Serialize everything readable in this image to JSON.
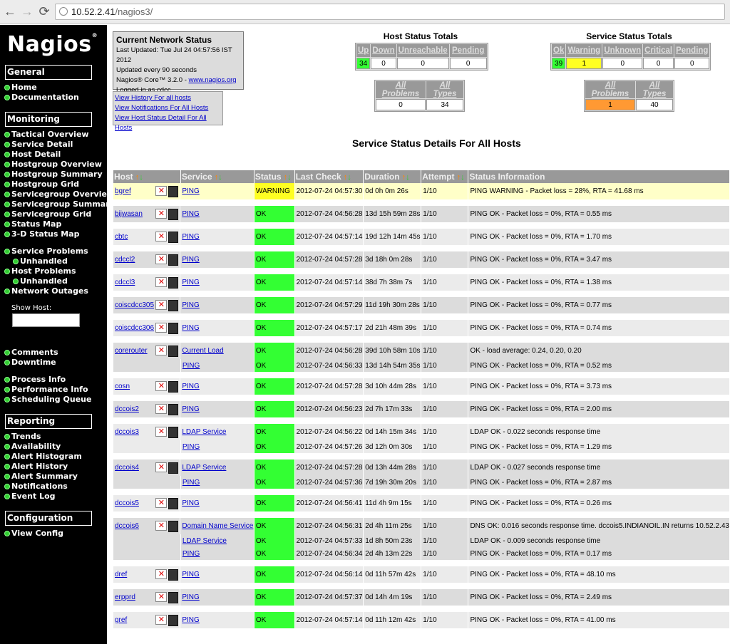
{
  "browser": {
    "host": "10.52.2.41",
    "path": "/nagios3/"
  },
  "logo": "Nagios",
  "sidebar": {
    "general": {
      "title": "General",
      "items": [
        "Home",
        "Documentation"
      ]
    },
    "monitoring": {
      "title": "Monitoring",
      "items": [
        "Tactical Overview",
        "Service Detail",
        "Host Detail",
        "Hostgroup Overview",
        "Hostgroup Summary",
        "Hostgroup Grid",
        "Servicegroup Overview",
        "Servicegroup Summary",
        "Servicegroup Grid",
        "Status Map",
        "3-D Status Map"
      ]
    },
    "problems": [
      "Service Problems",
      "Unhandled",
      "Host Problems",
      "Unhandled",
      "Network Outages"
    ],
    "show_host_label": "Show Host:",
    "misc": [
      "Comments",
      "Downtime",
      "Process Info",
      "Performance Info",
      "Scheduling Queue"
    ],
    "reporting": {
      "title": "Reporting",
      "items": [
        "Trends",
        "Availability",
        "Alert Histogram",
        "Alert History",
        "Alert Summary",
        "Notifications",
        "Event Log"
      ]
    },
    "configuration": {
      "title": "Configuration",
      "items": [
        "View Config"
      ]
    }
  },
  "status_box": {
    "title": "Current Network Status",
    "updated": "Last Updated: Tue Jul 24 04:57:56 IST 2012",
    "interval": "Updated every 90 seconds",
    "version_prefix": "Nagios® Core™ 3.2.0 - ",
    "version_link": "www.nagios.org",
    "logged": "Logged in as cdcc",
    "links": [
      "View History For all hosts",
      "View Notifications For All Hosts",
      "View Host Status Detail For All Hosts"
    ]
  },
  "host_totals": {
    "title": "Host Status Totals",
    "headers": [
      "Up",
      "Down",
      "Unreachable",
      "Pending"
    ],
    "values": [
      "34",
      "0",
      "0",
      "0"
    ],
    "summary_headers": [
      "All Problems",
      "All Types"
    ],
    "summary_values": [
      "0",
      "34"
    ]
  },
  "service_totals": {
    "title": "Service Status Totals",
    "headers": [
      "Ok",
      "Warning",
      "Unknown",
      "Critical",
      "Pending"
    ],
    "values": [
      "39",
      "1",
      "0",
      "0",
      "0"
    ],
    "summary_headers": [
      "All Problems",
      "All Types"
    ],
    "summary_values": [
      "1",
      "40"
    ]
  },
  "page_title": "Service Status Details For All Hosts",
  "columns": [
    "Host",
    "Service",
    "Status",
    "Last Check",
    "Duration",
    "Attempt",
    "Status Information"
  ],
  "colors": {
    "ok": "#33ff33",
    "warning": "#ffff22",
    "problems": "#ff9933"
  },
  "rows": [
    {
      "host": "bgref",
      "service": "PING",
      "status": "WARNING",
      "last_check": "2012-07-24 04:57:30",
      "duration": "0d 0h 0m 26s",
      "attempt": "1/10",
      "info": "PING WARNING - Packet loss = 28%, RTA = 41.68 ms"
    },
    {
      "host": "bijwasan",
      "service": "PING",
      "status": "OK",
      "last_check": "2012-07-24 04:56:28",
      "duration": "13d 15h 59m 28s",
      "attempt": "1/10",
      "info": "PING OK - Packet loss = 0%, RTA = 0.55 ms"
    },
    {
      "host": "cbtc",
      "service": "PING",
      "status": "OK",
      "last_check": "2012-07-24 04:57:14",
      "duration": "19d 12h 14m 45s",
      "attempt": "1/10",
      "info": "PING OK - Packet loss = 0%, RTA = 1.70 ms"
    },
    {
      "host": "cdccl2",
      "service": "PING",
      "status": "OK",
      "last_check": "2012-07-24 04:57:28",
      "duration": "3d 18h 0m 28s",
      "attempt": "1/10",
      "info": "PING OK - Packet loss = 0%, RTA = 3.47 ms"
    },
    {
      "host": "cdccl3",
      "service": "PING",
      "status": "OK",
      "last_check": "2012-07-24 04:57:14",
      "duration": "38d 7h 38m 7s",
      "attempt": "1/10",
      "info": "PING OK - Packet loss = 0%, RTA = 1.38 ms"
    },
    {
      "host": "coiscdcc305",
      "service": "PING",
      "status": "OK",
      "last_check": "2012-07-24 04:57:29",
      "duration": "11d 19h 30m 28s",
      "attempt": "1/10",
      "info": "PING OK - Packet loss = 0%, RTA = 0.77 ms"
    },
    {
      "host": "coiscdcc306",
      "service": "PING",
      "status": "OK",
      "last_check": "2012-07-24 04:57:17",
      "duration": "2d 21h 48m 39s",
      "attempt": "1/10",
      "info": "PING OK - Packet loss = 0%, RTA = 0.74 ms"
    },
    {
      "host": "corerouter",
      "service": "Current Load",
      "status": "OK",
      "last_check": "2012-07-24 04:56:28",
      "duration": "39d 10h 58m 10s",
      "attempt": "1/10",
      "info": "OK - load average: 0.24, 0.20, 0.20"
    },
    {
      "host": "",
      "service": "PING",
      "status": "OK",
      "last_check": "2012-07-24 04:56:33",
      "duration": "13d 14h 54m 35s",
      "attempt": "1/10",
      "info": "PING OK - Packet loss = 0%, RTA = 0.52 ms"
    },
    {
      "host": "cosn",
      "service": "PING",
      "status": "OK",
      "last_check": "2012-07-24 04:57:28",
      "duration": "3d 10h 44m 28s",
      "attempt": "1/10",
      "info": "PING OK - Packet loss = 0%, RTA = 3.73 ms"
    },
    {
      "host": "dccois2",
      "service": "PING",
      "status": "OK",
      "last_check": "2012-07-24 04:56:23",
      "duration": "2d 7h 17m 33s",
      "attempt": "1/10",
      "info": "PING OK - Packet loss = 0%, RTA = 2.00 ms"
    },
    {
      "host": "dccois3",
      "service": "LDAP Service",
      "status": "OK",
      "last_check": "2012-07-24 04:56:22",
      "duration": "0d 14h 15m 34s",
      "attempt": "1/10",
      "info": "LDAP OK - 0.022 seconds response time"
    },
    {
      "host": "",
      "service": "PING",
      "status": "OK",
      "last_check": "2012-07-24 04:57:26",
      "duration": "3d 12h 0m 30s",
      "attempt": "1/10",
      "info": "PING OK - Packet loss = 0%, RTA = 1.29 ms"
    },
    {
      "host": "dccois4",
      "service": "LDAP Service",
      "status": "OK",
      "last_check": "2012-07-24 04:57:28",
      "duration": "0d 13h 44m 28s",
      "attempt": "1/10",
      "info": "LDAP OK - 0.027 seconds response time"
    },
    {
      "host": "",
      "service": "PING",
      "status": "OK",
      "last_check": "2012-07-24 04:57:36",
      "duration": "7d 19h 30m 20s",
      "attempt": "1/10",
      "info": "PING OK - Packet loss = 0%, RTA = 2.87 ms"
    },
    {
      "host": "dccois5",
      "service": "PING",
      "status": "OK",
      "last_check": "2012-07-24 04:56:41",
      "duration": "11d 4h 9m 15s",
      "attempt": "1/10",
      "info": "PING OK - Packet loss = 0%, RTA = 0.26 ms"
    },
    {
      "host": "dccois6",
      "service": "Domain Name Service",
      "status": "OK",
      "last_check": "2012-07-24 04:56:31",
      "duration": "2d 4h 11m 25s",
      "attempt": "1/10",
      "info": "DNS OK: 0.016 seconds response time. dccois5.INDIANOIL.IN returns 10.52.2.43"
    },
    {
      "host": "",
      "service": "LDAP Service",
      "status": "OK",
      "last_check": "2012-07-24 04:57:33",
      "duration": "1d 8h 50m 23s",
      "attempt": "1/10",
      "info": "LDAP OK - 0.009 seconds response time"
    },
    {
      "host": "",
      "service": "PING",
      "status": "OK",
      "last_check": "2012-07-24 04:56:34",
      "duration": "2d 4h 13m 22s",
      "attempt": "1/10",
      "info": "PING OK - Packet loss = 0%, RTA = 0.17 ms"
    },
    {
      "host": "dref",
      "service": "PING",
      "status": "OK",
      "last_check": "2012-07-24 04:56:14",
      "duration": "0d 11h 57m 42s",
      "attempt": "1/10",
      "info": "PING OK - Packet loss = 0%, RTA = 48.10 ms"
    },
    {
      "host": "erpprd",
      "service": "PING",
      "status": "OK",
      "last_check": "2012-07-24 04:57:37",
      "duration": "0d 14h 4m 19s",
      "attempt": "1/10",
      "info": "PING OK - Packet loss = 0%, RTA = 2.49 ms"
    },
    {
      "host": "gref",
      "service": "PING",
      "status": "OK",
      "last_check": "2012-07-24 04:57:14",
      "duration": "0d 11h 12m 42s",
      "attempt": "1/10",
      "info": "PING OK - Packet loss = 0%, RTA = 41.00 ms"
    }
  ]
}
